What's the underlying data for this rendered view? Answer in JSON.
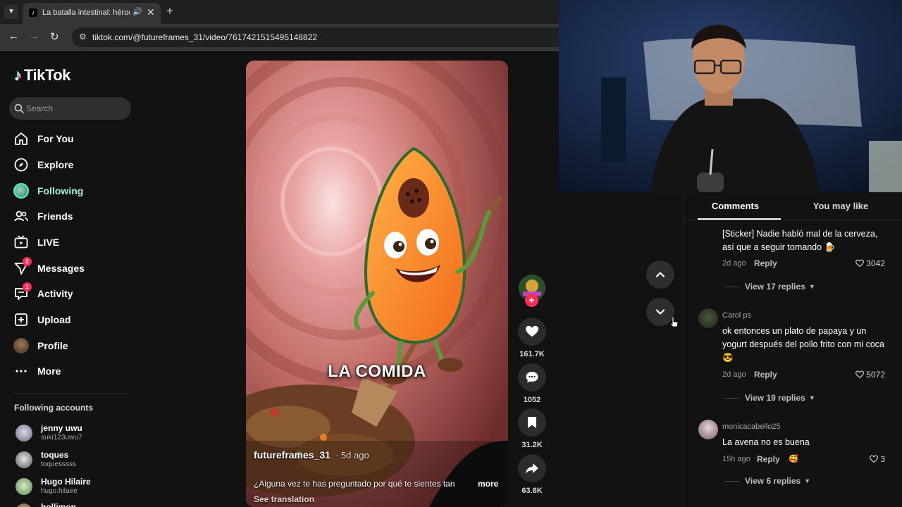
{
  "browser": {
    "tab_title": "La batalla intestinal: héroes",
    "url": "tiktok.com/@futureframes_31/video/7617421515495148822",
    "new_tab_symbol": "+"
  },
  "tiktok": {
    "logo_text": "TikTok",
    "search_placeholder": "Search",
    "nav": [
      {
        "label": "For You",
        "icon": "home-icon"
      },
      {
        "label": "Explore",
        "icon": "compass-icon"
      },
      {
        "label": "Following",
        "icon": "avatar"
      },
      {
        "label": "Friends",
        "icon": "friends-icon"
      },
      {
        "label": "LIVE",
        "icon": "live-icon"
      },
      {
        "label": "Messages",
        "icon": "messages-icon",
        "badge": "2"
      },
      {
        "label": "Activity",
        "icon": "activity-icon",
        "badge": "1"
      },
      {
        "label": "Upload",
        "icon": "upload-icon"
      },
      {
        "label": "Profile",
        "icon": "avatar"
      },
      {
        "label": "More",
        "icon": "more-icon"
      }
    ],
    "following_title": "Following accounts",
    "following_accounts": [
      {
        "name": "jenny uwu",
        "handle": "suki123uwu7"
      },
      {
        "name": "toques",
        "handle": "toquesssss"
      },
      {
        "name": "Hugo Hilaire",
        "handle": "hugo.hilaire"
      },
      {
        "name": "holljmon",
        "handle": ""
      }
    ]
  },
  "video": {
    "overlay_caption": "LA COMIDA",
    "author": "futureframes_31",
    "time": "· 5d ago",
    "description": "¿Alguna vez te has preguntado por qué te sientes tan",
    "more": "more",
    "see_translation": "See translation",
    "likes": "161.7K",
    "comments": "1052",
    "saves": "31.2K",
    "shares": "63.8K"
  },
  "comments_panel": {
    "tab_comments": "Comments",
    "tab_you_may_like": "You may like",
    "comments": [
      {
        "user": "",
        "text": "[Sticker] Nadie habló mal de la cerveza, así que a seguir tomando 🍺",
        "time": "2d ago",
        "reply": "Reply",
        "likes": "3042",
        "view_replies": "View 17 replies"
      },
      {
        "user": "Carol ps",
        "text": "ok entonces un plato de papaya y un yogurt después del pollo frito con mi coca 😎",
        "time": "2d ago",
        "reply": "Reply",
        "likes": "5072",
        "view_replies": "View 19 replies"
      },
      {
        "user": "monicacabello25",
        "text": "La avena no es buena",
        "time": "15h ago",
        "reply": "Reply",
        "likes": "3",
        "view_replies": "View 6 replies"
      }
    ]
  },
  "colors": {
    "accent": "#fe2c55",
    "cyan": "#25f4ee",
    "background": "#121212"
  }
}
